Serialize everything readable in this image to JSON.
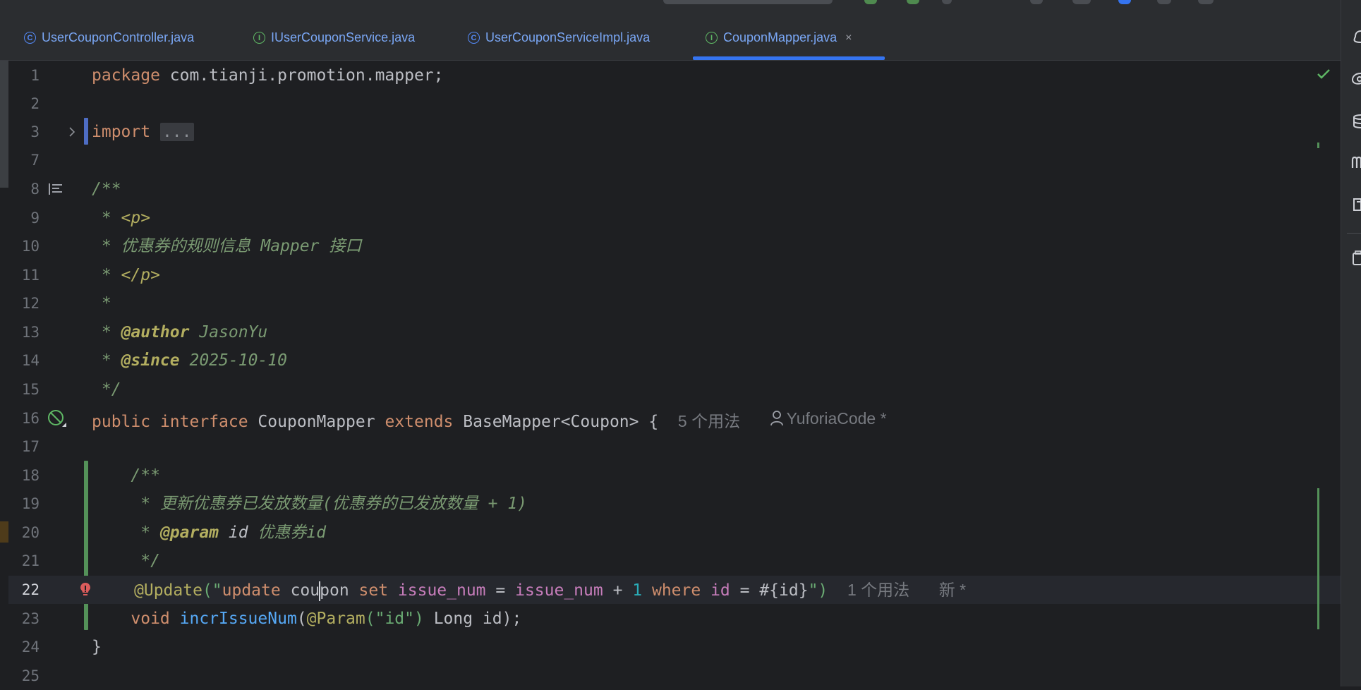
{
  "tabs": [
    {
      "label": "UserCouponController.java",
      "icon": "class-icon",
      "icon_glyph": "C",
      "active": false
    },
    {
      "label": "IUserCouponService.java",
      "icon": "interface-icon",
      "icon_glyph": "I",
      "active": false
    },
    {
      "label": "UserCouponServiceImpl.java",
      "icon": "class-icon",
      "icon_glyph": "C",
      "active": false
    },
    {
      "label": "CouponMapper.java",
      "icon": "interface-icon",
      "icon_glyph": "I",
      "active": true
    }
  ],
  "tab_close_glyph": "×",
  "code": {
    "line_numbers": [
      "1",
      "2",
      "3",
      "7",
      "8",
      "9",
      "10",
      "11",
      "12",
      "13",
      "14",
      "15",
      "16",
      "17",
      "18",
      "19",
      "20",
      "21",
      "22",
      "23",
      "24",
      "25"
    ],
    "package_kw": "package",
    "package_name": " com.tianji.promotion.mapper;",
    "import_kw": "import",
    "import_fold": "...",
    "doc_open": "/**",
    "doc_p_prefix": " * ",
    "doc_p_open": "<p>",
    "doc_desc": " * 优惠券的规则信息 Mapper 接口",
    "doc_p_close": "</p>",
    "doc_blank": " *",
    "doc_author_tag": "@author",
    "doc_author_value": " JasonYu",
    "doc_since_tag": "@since",
    "doc_since_value": " 2025-10-10",
    "doc_close": " */",
    "kw_public": "public",
    "kw_interface": "interface",
    "class_name": " CouponMapper ",
    "kw_extends": "extends",
    "base_type": " BaseMapper<Coupon> {",
    "usage_hint_16": "5 个用法",
    "author_hint": "YuforiaCode *",
    "m_doc_open": "    /**",
    "m_doc_desc": "     * 更新优惠券已发放数量(优惠券的已发放数量 + 1)",
    "m_doc_param_prefix": "     * ",
    "m_doc_param_tag": "@param",
    "m_doc_param_name": " id",
    "m_doc_param_desc": " 优惠券id",
    "m_doc_close": "     */",
    "ann_update": "@Update",
    "sql_open": "(\"",
    "sql_update": "update",
    "sql_table_a": " cou",
    "sql_table_b": "pon ",
    "sql_set": "set",
    "sql_col1": " issue_num",
    "sql_eq1": " = ",
    "sql_col2": "issue_num",
    "sql_plus": " + ",
    "sql_one": "1",
    "sql_where": " where",
    "sql_id": " id",
    "sql_eq2": " = ",
    "sql_param": "#{id}",
    "sql_close": "\")",
    "usage_hint_22": "1 个用法",
    "new_hint": "新 *",
    "m_void": "    void ",
    "m_name": "incrIssueNum",
    "m_paren": "(",
    "m_param_ann": "@Param",
    "m_param_str": "(\"id\")",
    "m_param_rest": " Long id);",
    "close_brace": "}"
  }
}
